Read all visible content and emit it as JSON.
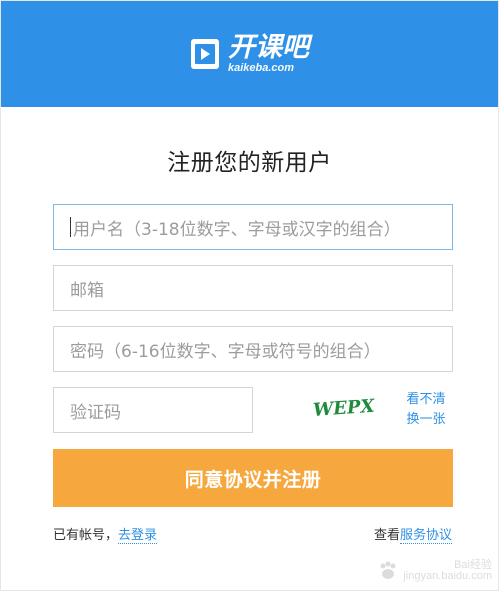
{
  "header": {
    "logo_cn": "开课吧",
    "logo_en": "kaikeba.com",
    "bg_color": "#2e90e6"
  },
  "title": "注册您的新用户",
  "form": {
    "username_placeholder": "用户名（3-18位数字、字母或汉字的组合）",
    "email_placeholder": "邮箱",
    "password_placeholder": "密码（6-16位数字、字母或符号的组合）",
    "captcha_placeholder": "验证码",
    "captcha_text": "WEPX",
    "captcha_refresh_line1": "看不清",
    "captcha_refresh_line2": "换一张",
    "submit_label": "同意协议并注册",
    "submit_color": "#f6a83f"
  },
  "footer": {
    "has_account_prefix": "已有帐号，",
    "login_link": "去登录",
    "view_prefix": "查看",
    "terms_link": "服务协议"
  },
  "watermark": {
    "brand": "Bai",
    "brand_suffix": "经验",
    "url": "jingyan.baidu.com"
  }
}
